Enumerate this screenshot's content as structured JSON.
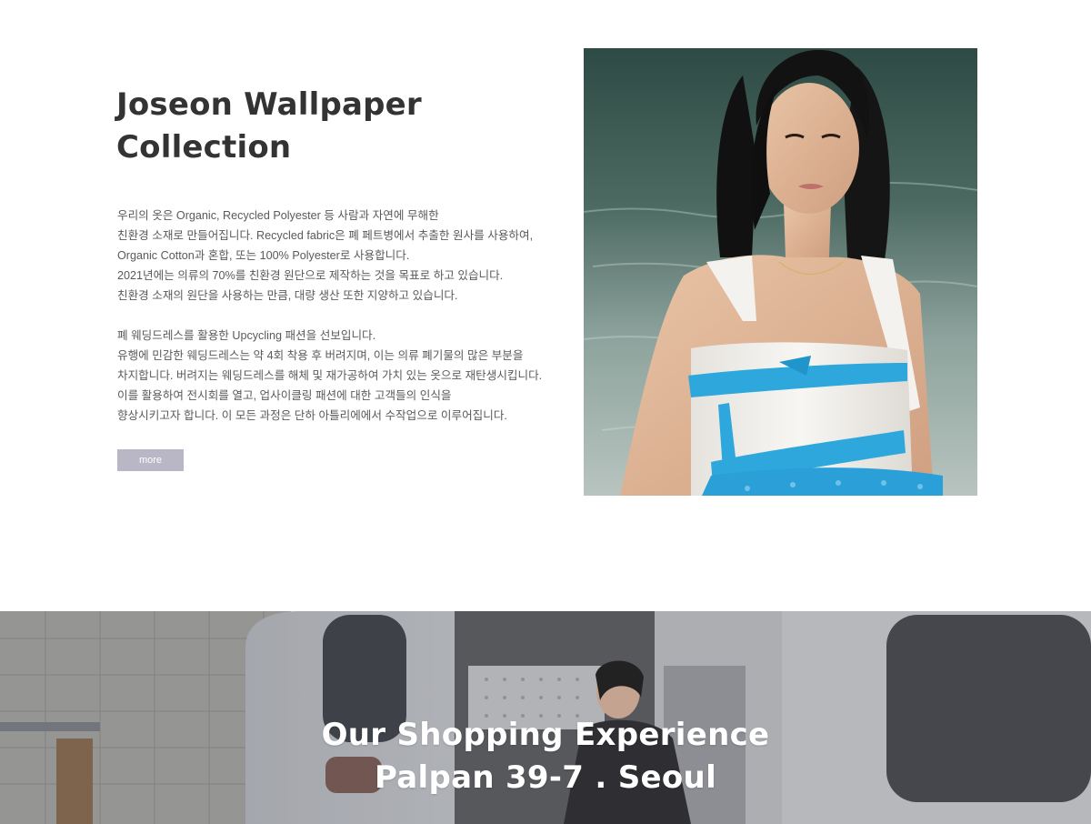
{
  "collection": {
    "title_lines": [
      "Joseon Wallpaper",
      "Collection"
    ],
    "paragraph1": [
      "우리의 옷은 Organic, Recycled Polyester 등 사람과 자연에 무해한",
      "친환경 소재로 만들어집니다. Recycled fabric은 폐 페트병에서 추출한 원사를 사용하여,",
      "Organic Cotton과 혼합, 또는 100% Polyester로 사용합니다.",
      "2021년에는 의류의 70%를 친환경 원단으로 제작하는 것을 목표로 하고 있습니다.",
      "친환경 소재의 원단을 사용하는 만큼, 대량 생산 또한 지양하고 있습니다."
    ],
    "paragraph2": [
      "폐 웨딩드레스를 활용한 Upcycling 패션을 선보입니다.",
      "유행에 민감한 웨딩드레스는 약 4회 착용 후 버려지며, 이는 의류 폐기물의 많은 부분을",
      "차지합니다. 버려지는 웨딩드레스를 해체 및 재가공하여 가치 있는 옷으로 재탄생시킵니다.",
      "이를 활용하여 전시회를 열고, 업사이클링 패션에 대한 고객들의 인식을",
      "향상시키고자 합니다. 이 모든 과정은 단하 아틀리에에서 수작업으로 이루어집니다."
    ],
    "more_label": "more",
    "more_button_color": "#b9b7c6"
  },
  "model_photo": {
    "subject": "model in white dress with blue ribbons by the water",
    "colors": {
      "water": "#3f5a52",
      "skin": "#e2b99c",
      "hair": "#141414",
      "dress": "#f2f0ec",
      "ribbon": "#2ea8dc"
    }
  },
  "experience": {
    "title_lines": [
      "Our Shopping Experience",
      "Palpan 39-7 . Seoul"
    ],
    "background_subject": "woman seated in doorway of silver camper trailer"
  }
}
